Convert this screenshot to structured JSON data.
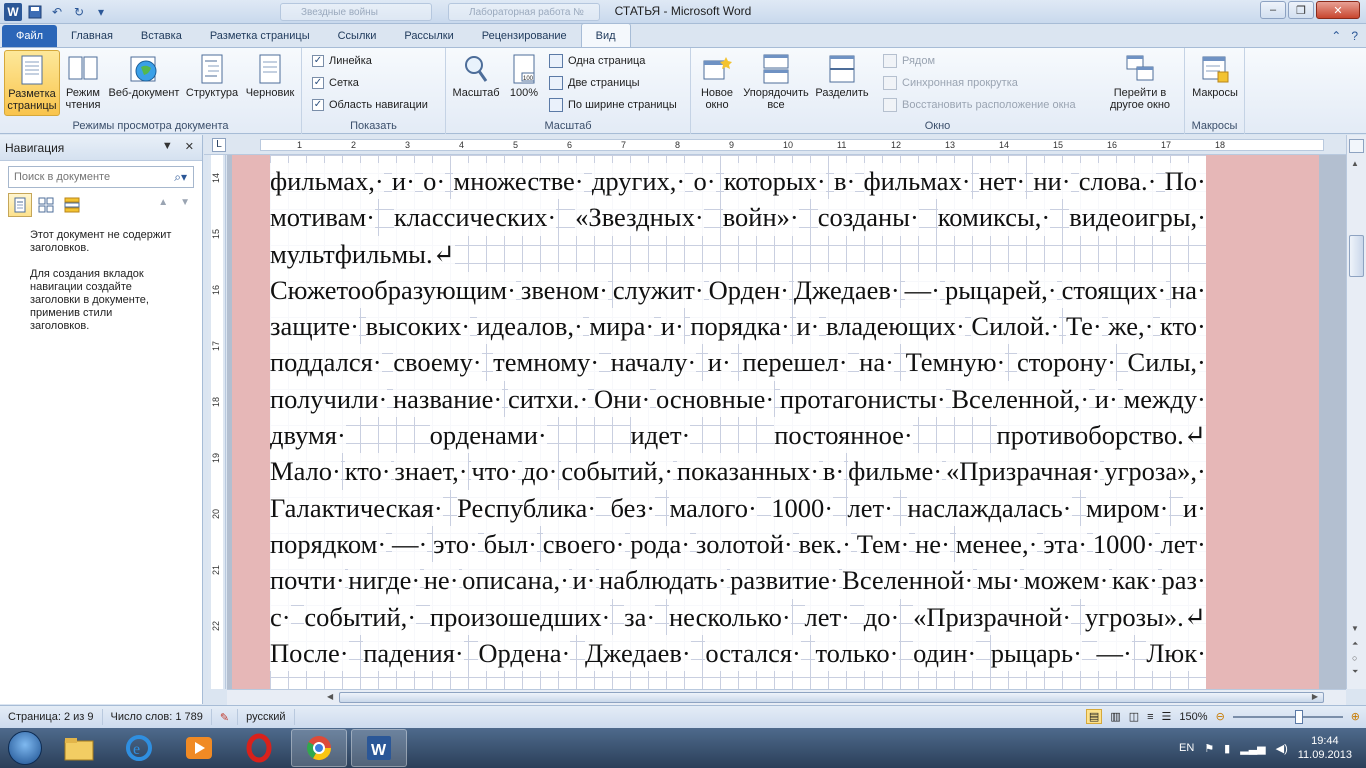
{
  "window": {
    "title": "СТАТЬЯ - Microsoft Word",
    "ghost_tabs": [
      "Звездные войны",
      "Лабораторная работа №"
    ]
  },
  "ribbon_tabs": [
    "Файл",
    "Главная",
    "Вставка",
    "Разметка страницы",
    "Ссылки",
    "Рассылки",
    "Рецензирование",
    "Вид"
  ],
  "active_tab": "Вид",
  "groups": {
    "views": {
      "label": "Режимы просмотра документа",
      "buttons": [
        "Разметка страницы",
        "Режим чтения",
        "Веб-документ",
        "Структура",
        "Черновик"
      ]
    },
    "show": {
      "label": "Показать",
      "checks": [
        {
          "label": "Линейка",
          "checked": true
        },
        {
          "label": "Сетка",
          "checked": true
        },
        {
          "label": "Область навигации",
          "checked": true
        }
      ]
    },
    "zoom": {
      "label": "Масштаб",
      "big": [
        "Масштаб",
        "100%"
      ],
      "small": [
        "Одна страница",
        "Две страницы",
        "По ширине страницы"
      ]
    },
    "window": {
      "label": "Окно",
      "big": [
        "Новое окно",
        "Упорядочить все",
        "Разделить"
      ],
      "small": [
        "Рядом",
        "Синхронная прокрутка",
        "Восстановить расположение окна"
      ],
      "switch": "Перейти в другое окно"
    },
    "macros": {
      "label": "Макросы",
      "button": "Макросы"
    }
  },
  "nav": {
    "title": "Навигация",
    "search_placeholder": "Поиск в документе",
    "msg1": "Этот документ не содержит заголовков.",
    "msg2": "Для создания вкладок навигации создайте заголовки в документе, применив стили заголовков."
  },
  "ruler": {
    "h_ticks": [
      "1",
      "2",
      "3",
      "4",
      "5",
      "6",
      "7",
      "8",
      "9",
      "10",
      "11",
      "12",
      "13",
      "14",
      "15",
      "16",
      "17",
      "18"
    ],
    "v_ticks": [
      "14",
      "15",
      "16",
      "17",
      "18",
      "19",
      "20",
      "21",
      "22"
    ]
  },
  "document": {
    "lines": [
      {
        "words": [
          "фильмах,·",
          "и·",
          "о·",
          "множестве·",
          "других,·",
          "о·",
          "которых·",
          "в·",
          "фильмах·",
          "нет·",
          "ни·",
          "слова.·",
          "По·"
        ]
      },
      {
        "words": [
          "мотивам·",
          "классических·",
          "«Звездных·",
          "войн»·",
          "созданы·",
          "комиксы,·",
          "видеоигры,·"
        ]
      },
      {
        "words": [
          "мультфильмы.↵"
        ],
        "last": true
      },
      {
        "words": [
          "Сюжетообразующим·",
          "звеном·",
          "служит·",
          "Орден·",
          "Джедаев·",
          "—·",
          "рыцарей,·",
          "стоящих·",
          "на·"
        ]
      },
      {
        "words": [
          "защите·",
          "высоких·",
          "идеалов,·",
          "мира·",
          "и·",
          "порядка·",
          "и·",
          "владеющих·",
          "Силой.·",
          "Те·",
          "же,·",
          "кто·"
        ]
      },
      {
        "words": [
          "поддался·",
          "своему·",
          "темному·",
          "началу·",
          "и·",
          "перешел·",
          "на·",
          "Темную·",
          "сторону·",
          "Силы,·"
        ]
      },
      {
        "words": [
          "получили·",
          "название·",
          "ситхи.·",
          "Они·",
          "основные·",
          "протагонисты·",
          "Вселенной,·",
          "и·",
          "между·"
        ]
      },
      {
        "words": [
          "двумя·",
          "орденами·",
          "идет·",
          "постоянное·",
          "противоборство.↵"
        ]
      },
      {
        "words": [
          "Мало·",
          "кто·",
          "знает,·",
          "что·",
          "до·",
          "событий,·",
          "показанных·",
          "в·",
          "фильме·",
          "«Призрачная·",
          "угроза»,·"
        ]
      },
      {
        "words": [
          "Галактическая·",
          "Республика·",
          "без·",
          "малого·",
          "1000·",
          "лет·",
          "наслаждалась·",
          "миром·",
          "и·"
        ]
      },
      {
        "words": [
          "порядком·",
          "—·",
          "это·",
          "был·",
          "своего·",
          "рода·",
          "золотой·",
          "век.·",
          "Тем·",
          "не·",
          "менее,·",
          "эта·",
          "1000·",
          "лет·"
        ]
      },
      {
        "words": [
          "почти·",
          "нигде·",
          "не·",
          "описана,·",
          "и·",
          "наблюдать·",
          "развитие·",
          "Вселенной·",
          "мы·",
          "можем·",
          "как·",
          "раз·"
        ]
      },
      {
        "words": [
          "с·",
          "событий,·",
          "произошедших·",
          "за·",
          "несколько·",
          "лет·",
          "до·",
          "«Призрачной·",
          "угрозы».↵"
        ]
      },
      {
        "words": [
          "После·",
          "падения·",
          "Ордена·",
          "Джедаев·",
          "остался·",
          "только·",
          "один·",
          "рыцарь·",
          "—·",
          "Люк·"
        ]
      }
    ]
  },
  "status": {
    "page": "Страница: 2 из 9",
    "words": "Число слов: 1 789",
    "lang": "русский",
    "zoom": "150%"
  },
  "tray": {
    "lang": "EN",
    "time": "19:44",
    "date": "11.09.2013"
  }
}
